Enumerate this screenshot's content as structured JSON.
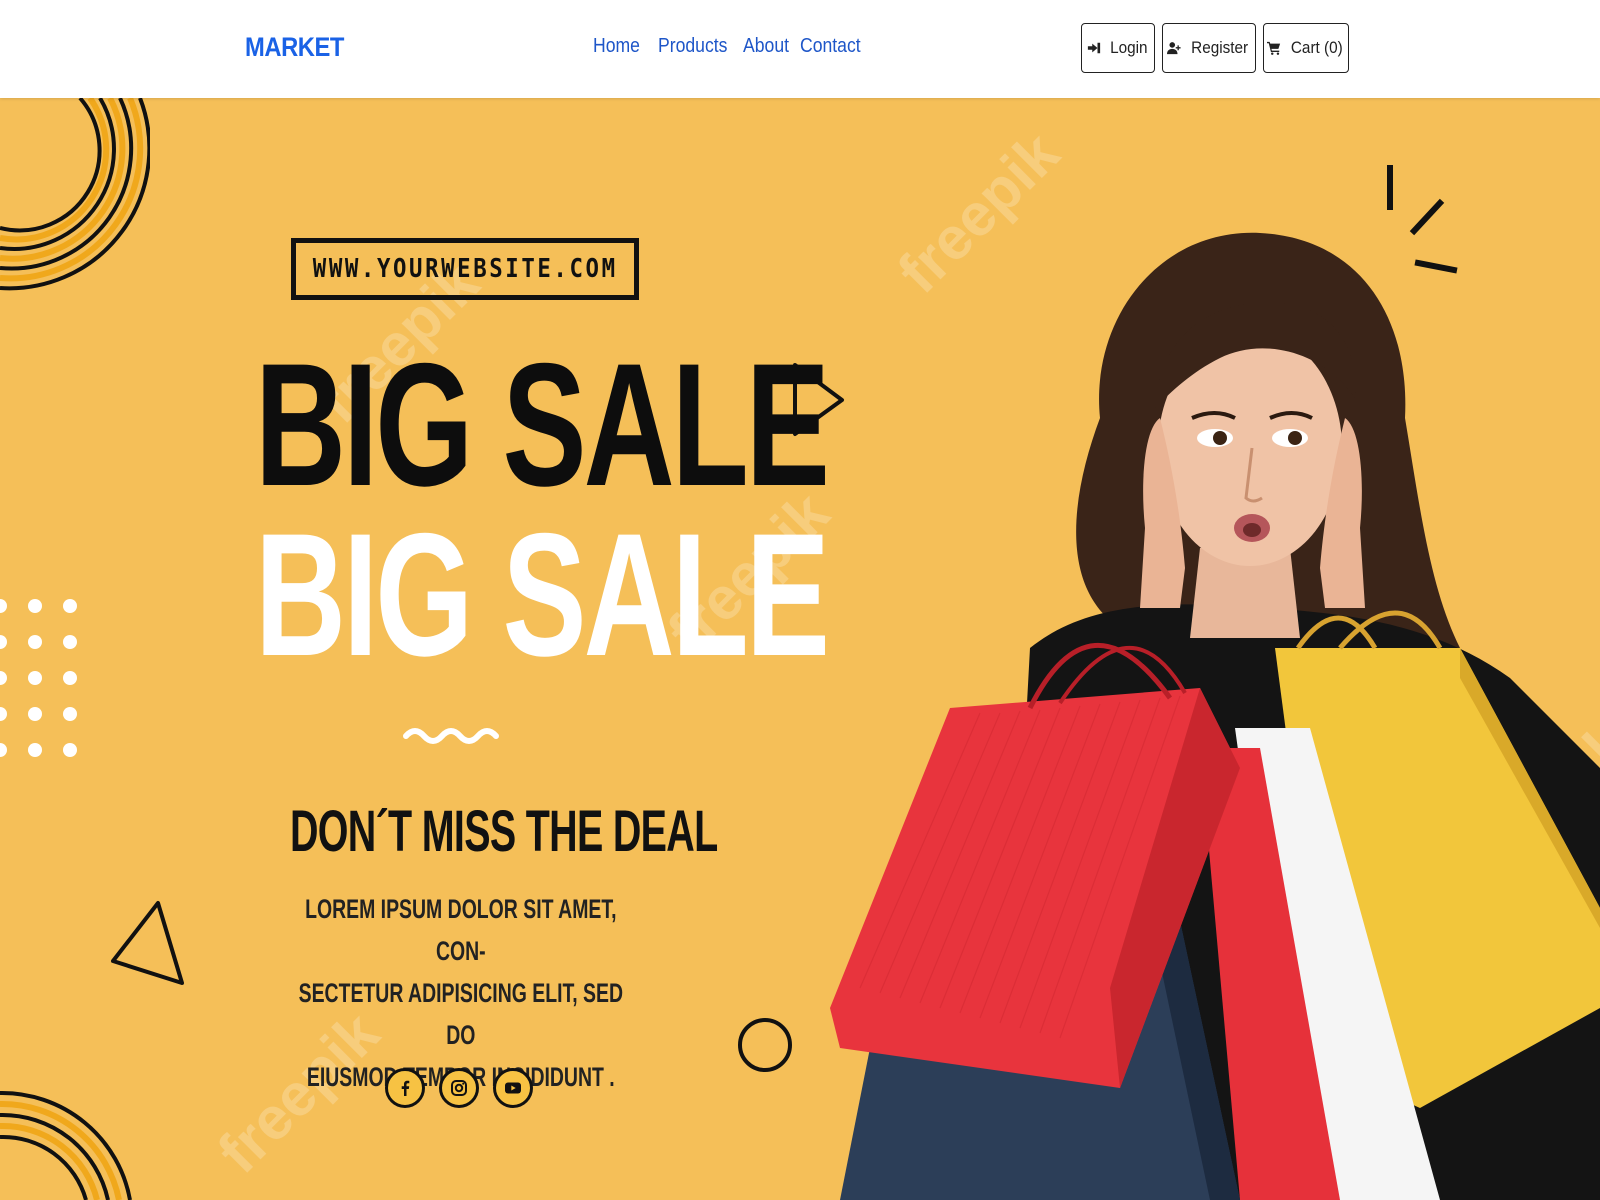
{
  "navbar": {
    "brand": "MARKET",
    "links": [
      "Home",
      "Products",
      "About",
      "Contact"
    ],
    "buttons": {
      "login": "Login",
      "register": "Register",
      "cart": "Cart (0)"
    }
  },
  "hero": {
    "website": "WWW.YOURWEBSITE.COM",
    "headline_1": "BIG SALE",
    "headline_2": "BIG SALE",
    "tagline": "DON´T MISS THE DEAL",
    "body_lines": [
      "LOREM IPSUM DOLOR SIT AMET, CON-",
      "SECTETUR ADIPISICING ELIT, SED DO",
      "EIUSMOD TEMPOR INCIDIDUNT ."
    ],
    "social_icons": [
      "facebook-icon",
      "instagram-icon",
      "youtube-icon"
    ],
    "watermark": "freepik"
  },
  "colors": {
    "brand": "#1a62e6",
    "nav_link": "#1e56c8",
    "hero_bg": "#f5bf58",
    "social_fill": "#f7c243"
  }
}
